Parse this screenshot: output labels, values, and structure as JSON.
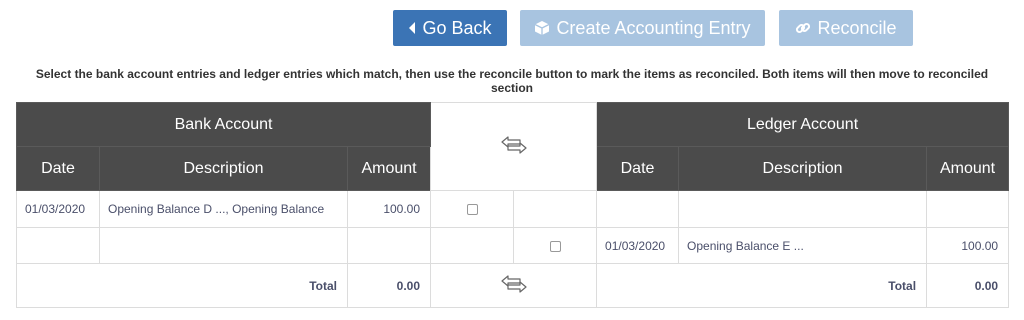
{
  "toolbar": {
    "go_back_label": "Go Back",
    "create_entry_label": "Create Accounting Entry",
    "reconcile_label": "Reconcile",
    "primary_color": "#3b74b5",
    "disabled_color": "#a8c4e0"
  },
  "instructions": "Select the bank account entries and ledger entries which match, then use the reconcile button to mark the items as reconciled. Both items will then move to reconciled section",
  "bank_account": {
    "title": "Bank Account",
    "columns": [
      "Date",
      "Description",
      "Amount"
    ],
    "rows": [
      {
        "date": "01/03/2020",
        "description": "Opening Balance D ..., Opening Balance",
        "amount": "100.00"
      }
    ],
    "total_label": "Total",
    "total_value": "0.00"
  },
  "ledger_account": {
    "title": "Ledger Account",
    "columns": [
      "Date",
      "Description",
      "Amount"
    ],
    "rows": [
      {
        "date": "01/03/2020",
        "description": "Opening Balance E ...",
        "amount": "100.00"
      }
    ],
    "total_label": "Total",
    "total_value": "0.00"
  },
  "icons": {
    "go_back": "caret-left-icon",
    "create_entry": "cube-icon",
    "reconcile": "link-icon",
    "swap": "swap-arrows-icon"
  },
  "header_color": "#4b4b4b"
}
